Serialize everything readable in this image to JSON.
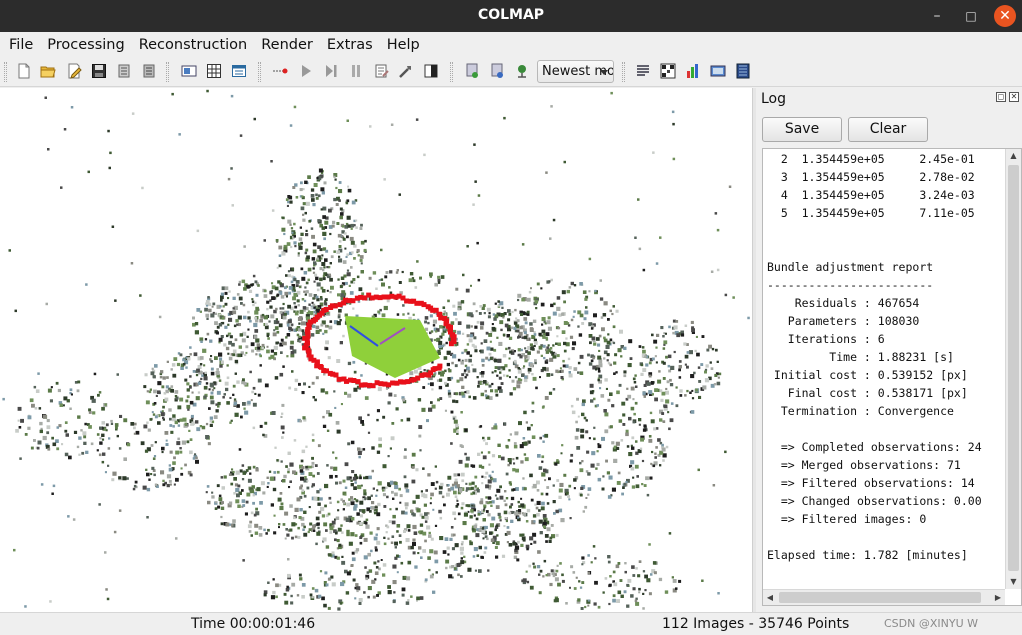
{
  "window": {
    "title": "COLMAP",
    "controls": {
      "minimize": "–",
      "maximize": "□",
      "close": "✕"
    }
  },
  "menu": [
    "File",
    "Processing",
    "Reconstruction",
    "Render",
    "Extras",
    "Help"
  ],
  "toolbar": {
    "icons": [
      "new-project-icon",
      "open-project-icon",
      "edit-project-icon",
      "save-project-icon",
      "import-model-icon",
      "export-model-icon",
      "feature-extraction-icon",
      "feature-matching-icon",
      "database-management-icon",
      "start-reconstruction-icon",
      "step-reconstruction-icon",
      "pause-reconstruction-icon",
      "reset-reconstruction-icon",
      "reconstruction-options-icon",
      "bundle-adjustment-icon",
      "dense-reconstruction-icon",
      "render-options-icon",
      "render-now-icon",
      "camera-icon",
      "log-icon",
      "match-matrix-icon",
      "model-statistics-icon",
      "grab-image-icon",
      "grab-movie-icon"
    ],
    "model_select": "Newest model"
  },
  "log": {
    "title": "Log",
    "save_label": "Save",
    "clear_label": "Clear",
    "lines": [
      "  2  1.354459e+05     2.45e-01",
      "  3  1.354459e+05     2.78e-02",
      "  4  1.354459e+05     3.24e-03",
      "  5  1.354459e+05     7.11e-05",
      "",
      "",
      "Bundle adjustment report",
      "------------------------",
      "    Residuals : 467654",
      "   Parameters : 108030",
      "   Iterations : 6",
      "         Time : 1.88231 [s]",
      " Initial cost : 0.539152 [px]",
      "   Final cost : 0.538171 [px]",
      "  Termination : Convergence",
      "",
      "  => Completed observations: 24",
      "  => Merged observations: 71",
      "  => Filtered observations: 14",
      "  => Changed observations: 0.00",
      "  => Filtered images: 0",
      "",
      "Elapsed time: 1.782 [minutes]"
    ]
  },
  "status": {
    "time": "Time 00:00:01:46",
    "summary": "112 Images - 35746 Points",
    "watermark": "CSDN @XINYU W"
  },
  "colors": {
    "titlebar": "#2c2c2c",
    "close": "#e95420",
    "camera_path": "#e8101a",
    "ground_patch": "#8fd03a"
  }
}
